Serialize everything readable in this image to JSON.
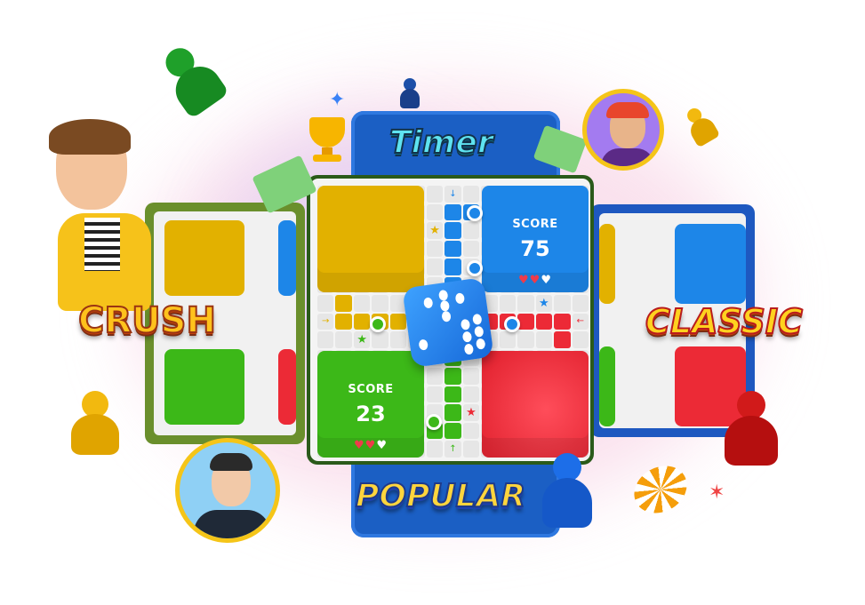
{
  "labels": {
    "timer": "Timer",
    "crush": "CRUSH",
    "classic": "CLASSIC",
    "popular": "POPULAR"
  },
  "board": {
    "players": [
      {
        "color": "blue",
        "score_label": "SCORE",
        "score": "75",
        "lives_filled": 2,
        "lives_total": 3
      },
      {
        "color": "green",
        "score_label": "SCORE",
        "score": "23",
        "lives_filled": 2,
        "lives_total": 3
      }
    ],
    "arrows": {
      "top": "↓",
      "left": "→",
      "right": "←",
      "bottom": "↑"
    },
    "dice_value_shown": 6
  },
  "colors": {
    "yellow": "#e2b100",
    "blue": "#1d86e8",
    "green": "#3cb818",
    "red": "#ec2a36",
    "panel": "#1b5fc4",
    "gold": "#f5c518"
  }
}
